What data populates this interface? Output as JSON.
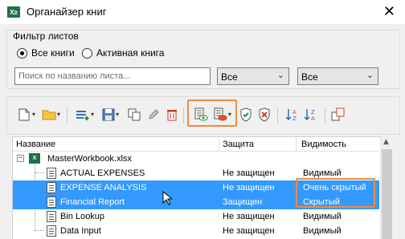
{
  "window": {
    "icon_label": "X≥",
    "title": "Органайзер книг",
    "close_glyph": "✕"
  },
  "filter": {
    "legend": "Фильтр листов",
    "radio_all": "Все книги",
    "radio_active": "Активная книга",
    "search_placeholder": "Поиск по названию листа...",
    "select1_value": "Все",
    "select2_value": "Все",
    "selected_radio": "radio_all"
  },
  "toolbar": {
    "icons": [
      "new-sheet-icon",
      "open-folder-icon",
      "insert-sheet-icon",
      "save-icon",
      "copy-icon",
      "rename-pencil-icon",
      "delete-trash-icon",
      "show-sheet-icon",
      "hide-sheet-icon",
      "protect-shield-icon",
      "unprotect-shield-icon",
      "sort-az-icon",
      "sort-za-icon",
      "switch-icon"
    ]
  },
  "grid": {
    "columns": [
      "Название",
      "Защита",
      "Видимость"
    ],
    "workbook": {
      "name": "MasterWorkbook.xlsx",
      "icon_label": "X"
    },
    "rows": [
      {
        "name": "ACTUAL EXPENSES",
        "protection": "Не защищен",
        "visibility": "Видимый",
        "selected": false
      },
      {
        "name": "EXPENSE ANALYSIS",
        "protection": "Не защищен",
        "visibility": "Очень скрытый",
        "selected": true
      },
      {
        "name": "Financial Report",
        "protection": "Защищен",
        "visibility": "Скрытый",
        "selected": true
      },
      {
        "name": "Bin Lookup",
        "protection": "Не защищен",
        "visibility": "Видимый",
        "selected": false
      },
      {
        "name": "Data Input",
        "protection": "Не защищен",
        "visibility": "Видимый",
        "selected": false
      }
    ]
  },
  "colors": {
    "selection": "#3399ff",
    "highlight_outline": "#f08a3c",
    "excel_green": "#1e7145"
  }
}
